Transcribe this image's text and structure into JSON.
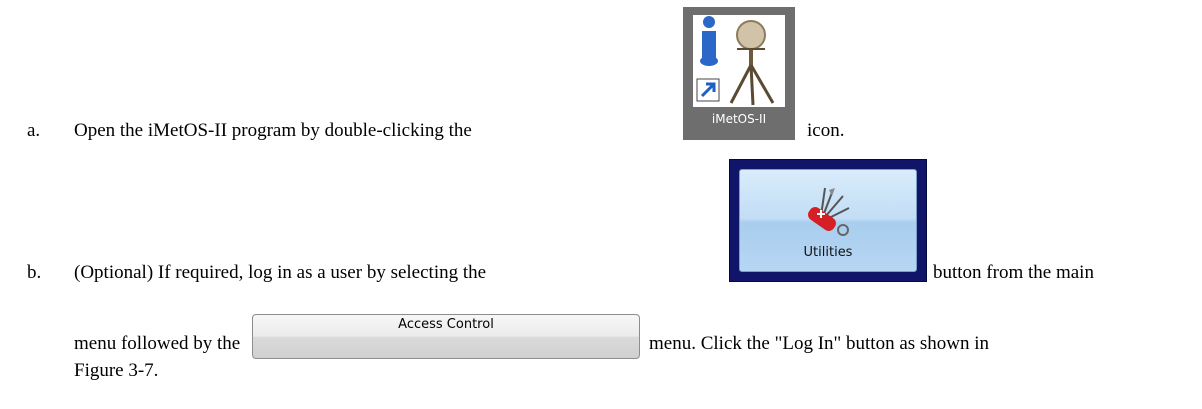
{
  "items": [
    {
      "marker": "a.",
      "text_before": "Open the iMetOS-II program by double-clicking the",
      "text_after": "icon."
    },
    {
      "marker": "b.",
      "text_before": "(Optional) If required, log in as a user by selecting the",
      "text_after": "button from the main",
      "line2_before": "menu followed by the",
      "line2_after": "menu.  Click the \"Log In\" button as shown in",
      "line3": "Figure 3-7."
    }
  ],
  "desktop_icon": {
    "caption": "iMetOS-II",
    "icon": "imetos-app-icon"
  },
  "utilities_button": {
    "label": "Utilities",
    "icon": "swiss-army-knife-icon"
  },
  "access_control_button": {
    "label": "Access Control"
  }
}
